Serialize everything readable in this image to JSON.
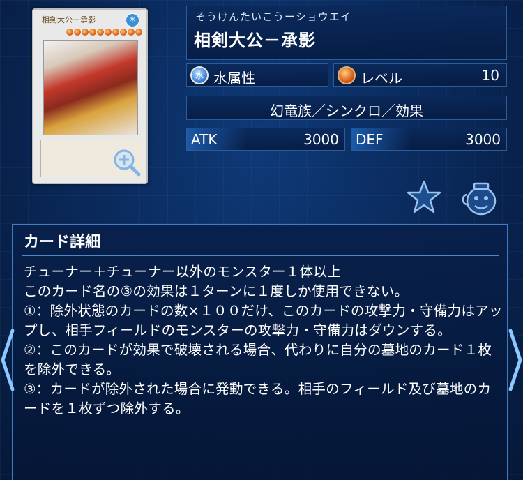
{
  "card": {
    "furigana": "そうけんたいこうーショウエイ",
    "name": "相剣大公－承影",
    "attribute_symbol": "水",
    "attribute": "水属性",
    "level_label": "レベル",
    "level": "10",
    "type_line": "幻竜族／シンクロ／効果",
    "atk_label": "ATK",
    "atk": "3000",
    "def_label": "DEF",
    "def": "3000",
    "thumbnail_name": "相剣大公－承影"
  },
  "detail": {
    "title": "カード詳細",
    "text": "チューナー＋チューナー以外のモンスター１体以上\nこのカード名の③の効果は１ターンに１度しか使用できない。\n①：除外状態のカードの数×１００だけ、このカードの攻撃力・守備力はアップし、相手フィールドのモンスターの攻撃力・守備力はダウンする。\n②：このカードが効果で破壊される場合、代わりに自分の墓地のカード１枚を除外できる。\n③：カードが除外された場合に発動できる。相手のフィールド及び墓地のカードを１枚ずつ除外する。"
  },
  "icons": {
    "zoom": "zoom-in-icon",
    "favorite": "star-icon",
    "pot": "pot-of-greed-icon",
    "prev": "chevron-left-icon",
    "next": "chevron-right-icon"
  },
  "colors": {
    "background": "#0a2a5c",
    "panel_border": "#3f7cc4",
    "water_attribute": "#3f86d6",
    "level_star": "#d85e1c"
  }
}
